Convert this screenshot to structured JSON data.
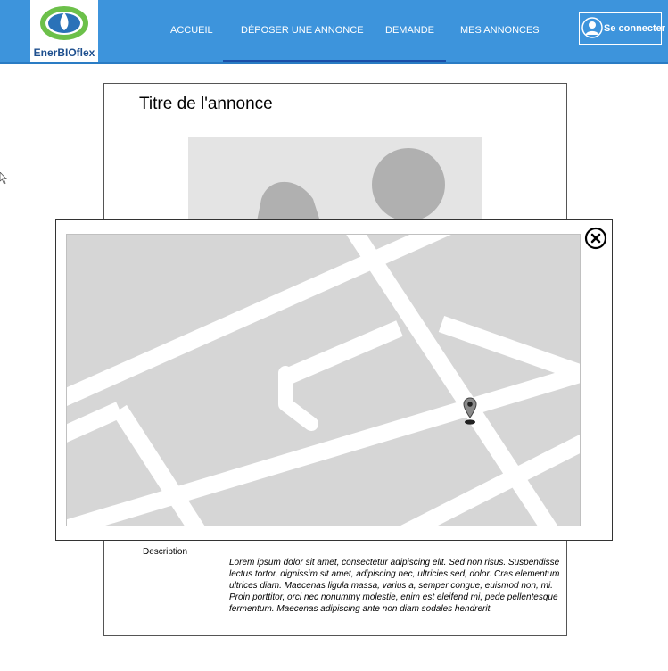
{
  "header": {
    "logo_text": "EnerBIOflex",
    "nav": [
      "ACCUEIL",
      "DÉPOSER UNE ANNONCE",
      "DEMANDE",
      "MES ANNONCES"
    ],
    "active_nav": "DÉPOSER UNE ANNONCE",
    "login_label": "Se connecter"
  },
  "listing": {
    "title": "Titre de l'annonce",
    "description_label": "Description",
    "description_text": "Lorem ipsum dolor sit amet, consectetur adipiscing elit. Sed non risus. Suspendisse lectus tortor, dignissim sit amet, adipiscing nec, ultricies sed, dolor. Cras elementum ultrices diam. Maecenas ligula massa, varius a, semper congue, euismod non, mi. Proin porttitor, orci nec nonummy molestie, enim est eleifend mi, pede pellentesque fermentum. Maecenas adipiscing ante non diam sodales hendrerit."
  },
  "map_modal": {
    "close_icon": "close-circle-icon",
    "marker_icon": "map-pin-icon"
  },
  "colors": {
    "navbar": "#3d94dc",
    "active_indicator": "#1a4fa8",
    "map_background": "#d6d6d6",
    "map_roads": "#ffffff"
  }
}
